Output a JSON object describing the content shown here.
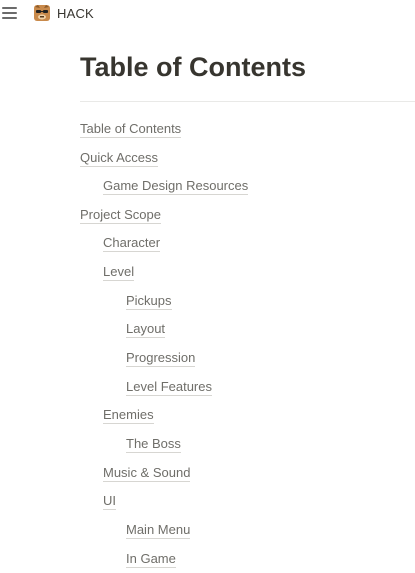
{
  "topbar": {
    "workspace_name": "HACK",
    "menu_icon": "hamburger-menu-icon",
    "logo_icon": "workspace-logo-icon"
  },
  "page": {
    "title": "Table of Contents"
  },
  "toc": {
    "items": [
      {
        "label": "Table of Contents",
        "level": 0
      },
      {
        "label": "Quick Access",
        "level": 0
      },
      {
        "label": "Game Design Resources",
        "level": 1
      },
      {
        "label": "Project Scope",
        "level": 0
      },
      {
        "label": "Character",
        "level": 1
      },
      {
        "label": "Level",
        "level": 1
      },
      {
        "label": "Pickups",
        "level": 2
      },
      {
        "label": "Layout",
        "level": 2
      },
      {
        "label": "Progression",
        "level": 2
      },
      {
        "label": "Level Features",
        "level": 2
      },
      {
        "label": "Enemies",
        "level": 1
      },
      {
        "label": "The Boss",
        "level": 2
      },
      {
        "label": "Music & Sound",
        "level": 1
      },
      {
        "label": "UI",
        "level": 1
      },
      {
        "label": "Main Menu",
        "level": 2
      },
      {
        "label": "In Game",
        "level": 2
      }
    ]
  }
}
